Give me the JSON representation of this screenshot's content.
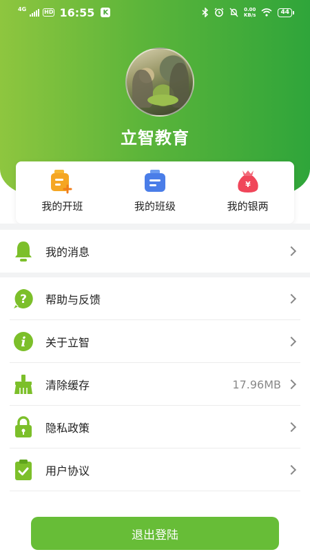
{
  "status_bar": {
    "network": "4G",
    "hd": "HD",
    "time": "16:55",
    "app_badge": "K",
    "speed_value": "0.00",
    "speed_unit": "KB/s",
    "battery": "44"
  },
  "profile": {
    "name": "立智教育"
  },
  "quick_actions": [
    {
      "label": "我的开班",
      "icon": "class-add-icon",
      "color": "#f5a623"
    },
    {
      "label": "我的班级",
      "icon": "class-icon",
      "color": "#4a7de8"
    },
    {
      "label": "我的银两",
      "icon": "money-bag-icon",
      "color": "#f0465a"
    }
  ],
  "menu": {
    "messages": {
      "label": "我的消息",
      "icon": "bell-icon"
    },
    "help": {
      "label": "帮助与反馈",
      "icon": "question-icon"
    },
    "about": {
      "label": "关于立智",
      "icon": "info-icon"
    },
    "cache": {
      "label": "清除缓存",
      "icon": "broom-icon",
      "value": "17.96MB"
    },
    "privacy": {
      "label": "隐私政策",
      "icon": "lock-icon"
    },
    "agreement": {
      "label": "用户协议",
      "icon": "clipboard-check-icon"
    }
  },
  "logout_label": "退出登陆",
  "colors": {
    "brand_green": "#67bd37",
    "icon_green": "#7cbf2a",
    "header_start": "#8ec63f",
    "header_end": "#2fa53a"
  }
}
